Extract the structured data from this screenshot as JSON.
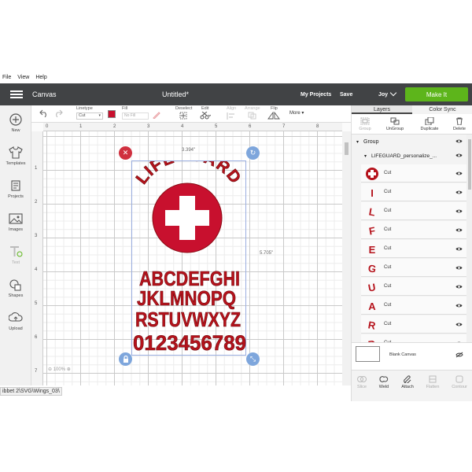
{
  "menubar": {
    "file": "File",
    "view": "View",
    "help": "Help"
  },
  "header": {
    "app_title": "Canvas",
    "doc_title": "Untitled*",
    "my_projects": "My Projects",
    "save": "Save",
    "machine": "Joy",
    "make_it": "Make It",
    "make_it_color": "#5db51b",
    "bar_color": "#414345"
  },
  "sidebar": {
    "items": [
      {
        "label": "New",
        "icon": "plus-circle-icon"
      },
      {
        "label": "Templates",
        "icon": "shirt-icon"
      },
      {
        "label": "Projects",
        "icon": "projects-icon"
      },
      {
        "label": "Images",
        "icon": "image-icon"
      },
      {
        "label": "Text",
        "icon": "text-icon"
      },
      {
        "label": "Shapes",
        "icon": "shapes-icon"
      },
      {
        "label": "Upload",
        "icon": "upload-icon"
      }
    ]
  },
  "toolbar": {
    "linetype_label": "Linetype",
    "linetype_value": "Cut",
    "fill_label": "Fill",
    "fill_value": "No Fill",
    "deselect": "Deselect",
    "edit": "Edit",
    "align": "Align",
    "arrange": "Arrange",
    "flip": "Flip",
    "more": "More",
    "swatch_color": "#c8102e"
  },
  "canvas": {
    "ruler_top": [
      "0",
      "1",
      "2",
      "3",
      "4",
      "5",
      "6",
      "7",
      "8"
    ],
    "ruler_left": [
      "1",
      "2",
      "3",
      "4",
      "5",
      "6",
      "7"
    ],
    "width_label": "3.394\"",
    "height_label": "5.705\"",
    "zoom": "100%",
    "design": {
      "arc_text": "LIFEGUARD",
      "line1": "ABCDEFGHI",
      "line2": "JKLMNOPQ",
      "line3": "RSTUVWXYZ",
      "line4": "0123456789",
      "color": "#b5121b"
    }
  },
  "status": {
    "path": "ibbet 2\\SVG\\Wings_03\\"
  },
  "panel": {
    "tabs": [
      "Layers",
      "Color Sync"
    ],
    "tools": [
      "Group",
      "UnGroup",
      "Duplicate",
      "Delete"
    ],
    "group_name": "Group",
    "subgroup_name": "LIFEGUARD_personalize_...",
    "layers": [
      {
        "glyph": "+",
        "name": "Cut"
      },
      {
        "glyph": "I",
        "name": "Cut"
      },
      {
        "glyph": "L",
        "name": "Cut"
      },
      {
        "glyph": "F",
        "name": "Cut"
      },
      {
        "glyph": "E",
        "name": "Cut"
      },
      {
        "glyph": "G",
        "name": "Cut"
      },
      {
        "glyph": "U",
        "name": "Cut"
      },
      {
        "glyph": "A",
        "name": "Cut"
      },
      {
        "glyph": "R",
        "name": "Cut"
      },
      {
        "glyph": "D",
        "name": "Cut"
      }
    ],
    "blank_canvas": "Blank Canvas",
    "bottom_tools": [
      "Slice",
      "Weld",
      "Attach",
      "Flatten",
      "Contour"
    ]
  }
}
